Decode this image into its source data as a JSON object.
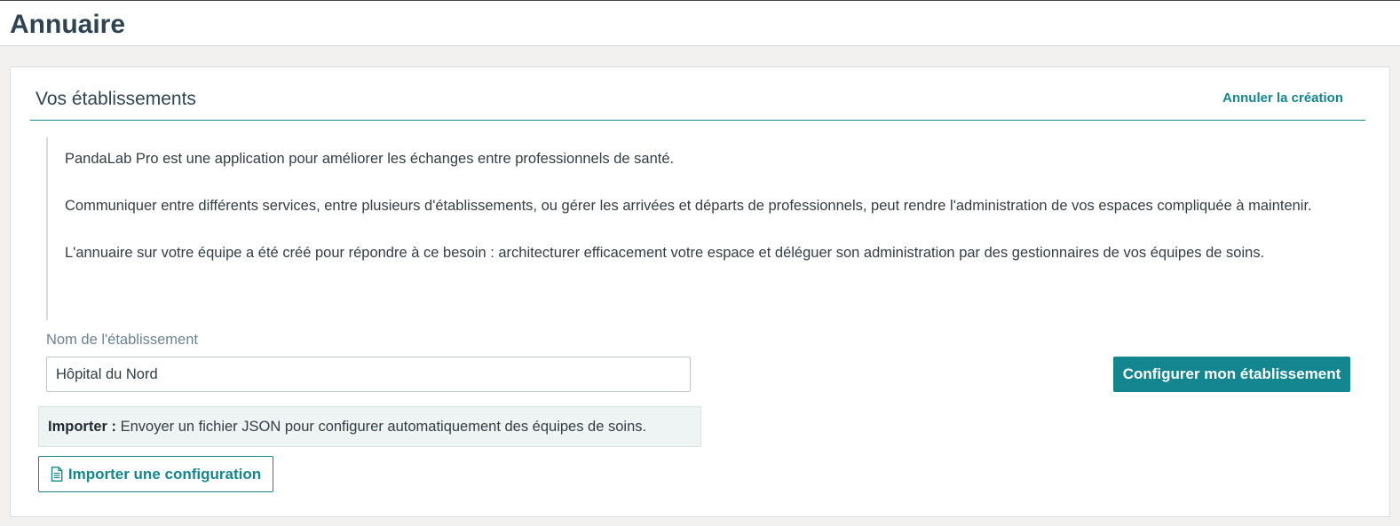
{
  "header": {
    "title": "Annuaire"
  },
  "section": {
    "title": "Vos établissements",
    "cancel_label": "Annuler la création"
  },
  "intro": {
    "paragraphs": [
      "PandaLab Pro est une application pour améliorer les échanges entre professionnels de santé.",
      "Communiquer entre différents services, entre plusieurs d'établissements, ou gérer les arrivées et départs de professionnels, peut rendre l'administration de vos espaces compliquée à maintenir.",
      "L'annuaire sur votre équipe a été créé pour répondre à ce besoin : architecturer efficacement votre espace et déléguer son administration par des gestionnaires de vos équipes de soins."
    ]
  },
  "form": {
    "name_label": "Nom de l'établissement",
    "name_value": "Hôpital du Nord",
    "configure_label": "Configurer mon établissement"
  },
  "import": {
    "info_bold": "Importer :",
    "info_text": " Envoyer un fichier JSON pour configurer automatiquement des équipes de soins.",
    "button_label": "Importer une configuration",
    "button_icon": "document-icon"
  },
  "colors": {
    "accent": "#13868f",
    "title": "#2e4452",
    "background": "#f3f1ef",
    "info_background": "#eef4f4"
  }
}
